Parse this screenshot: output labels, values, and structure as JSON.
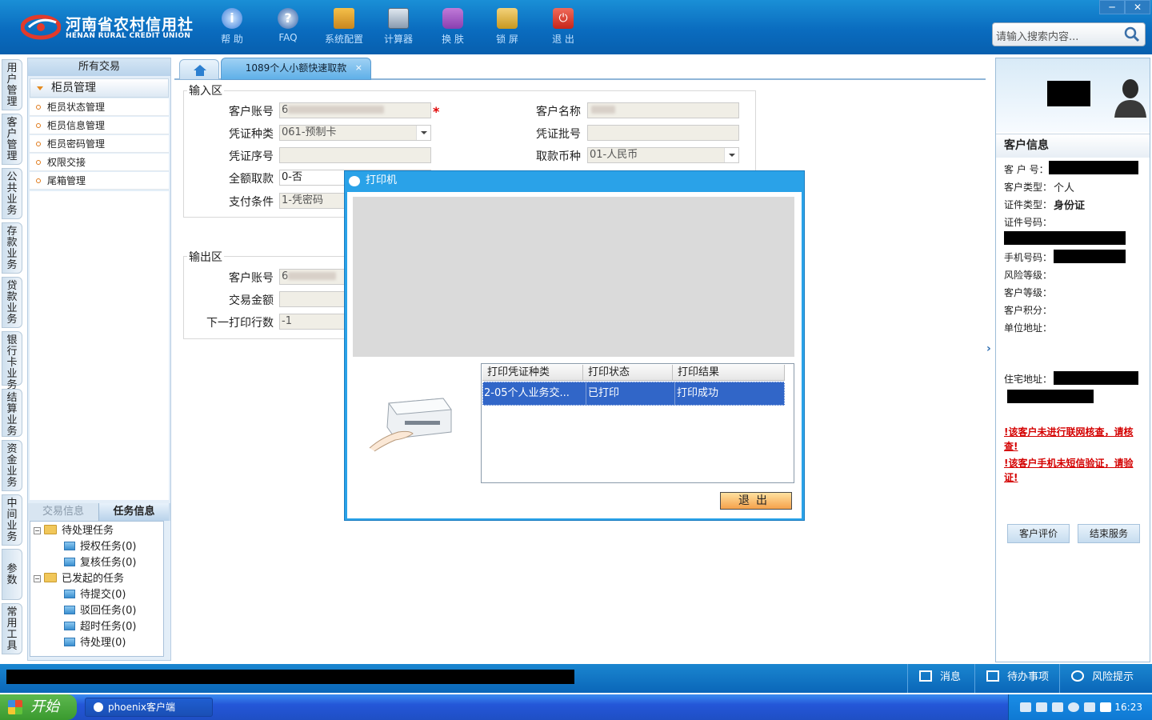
{
  "header": {
    "logo_cn": "河南省农村信用社",
    "logo_en": "HENAN RURAL CREDIT UNION",
    "toolbar": [
      {
        "label": "帮 助",
        "icon": "info-icon"
      },
      {
        "label": "FAQ",
        "icon": "question-icon"
      },
      {
        "label": "系统配置",
        "icon": "toolbox-icon"
      },
      {
        "label": "计算器",
        "icon": "calculator-icon"
      },
      {
        "label": "换 肤",
        "icon": "shirt-icon"
      },
      {
        "label": "锁 屏",
        "icon": "lock-icon"
      },
      {
        "label": "退 出",
        "icon": "power-icon"
      }
    ],
    "search_placeholder": "请输入搜索内容...",
    "win_minimize": "─",
    "win_close": "✕"
  },
  "vtabs": [
    "用户管理",
    "客户管理",
    "公共业务",
    "存款业务",
    "贷款业务",
    "银行卡业务",
    "结算业务",
    "资金业务",
    "中间业务",
    "参数",
    "常用工具"
  ],
  "left_panel": {
    "title": "所有交易",
    "group": "柜员管理",
    "items": [
      "柜员状态管理",
      "柜员信息管理",
      "柜员密码管理",
      "权限交接",
      "尾箱管理"
    ],
    "tabs": [
      "交易信息",
      "任务信息"
    ],
    "tree": {
      "pending": "待处理任务",
      "pending_children": [
        "授权任务(0)",
        "复核任务(0)"
      ],
      "initiated": "已发起的任务",
      "initiated_children": [
        "待提交(0)",
        "驳回任务(0)",
        "超时任务(0)",
        "待处理(0)"
      ]
    }
  },
  "tabs": {
    "active": "1089个人小额快速取款",
    "close": "×"
  },
  "input_section": {
    "title": "输入区",
    "account_label": "客户账号",
    "account_value": "6",
    "required_mark": "*",
    "name_label": "客户名称",
    "voucher_type_label": "凭证种类",
    "voucher_type_value": "061-预制卡",
    "voucher_batch_label": "凭证批号",
    "voucher_seq_label": "凭证序号",
    "currency_label": "取款币种",
    "currency_value": "01-人民币",
    "full_withdraw_label": "全额取款",
    "full_withdraw_value": "0-否",
    "pay_condition_label": "支付条件",
    "pay_condition_value": "1-凭密码"
  },
  "output_section": {
    "title": "输出区",
    "account_label": "客户账号",
    "account_value": "6",
    "amount_label": "交易金额",
    "next_line_label": "下一打印行数",
    "next_line_value": "-1"
  },
  "dialog": {
    "title": "打印机",
    "columns": [
      "打印凭证种类",
      "打印状态",
      "打印结果"
    ],
    "rows": [
      [
        "2-05个人业务交...",
        "已打印",
        "打印成功"
      ]
    ],
    "exit_button": "退出"
  },
  "customer_panel": {
    "title": "客户信息",
    "fields": {
      "customer_no": "客 户 号：",
      "customer_type_label": "客户类型：",
      "customer_type_value": "个人",
      "id_type_label": "证件类型：",
      "id_type_value": "身份证",
      "id_no_label": "证件号码：",
      "phone_label": "手机号码：",
      "risk_label": "风险等级：",
      "level_label": "客户等级：",
      "points_label": "客户积分：",
      "work_addr_label": "单位地址：",
      "home_addr_label": "住宅地址："
    },
    "warnings": [
      "!该客户未进行联网核查，请核查!",
      "!该客户手机未短信验证，请验证!"
    ],
    "buttons": [
      "客户评价",
      "结束服务"
    ]
  },
  "statusbar": {
    "items": [
      "消息",
      "待办事项",
      "风险提示"
    ]
  },
  "taskbar": {
    "start": "开始",
    "app": "phoenix客户端",
    "time": "16:23"
  },
  "colors": {
    "header_blue": "#0a6cbf",
    "dialog_blue": "#2aa2e8",
    "selection_blue": "#3166c8",
    "warning_red": "#d40000",
    "exit_orange": "#f5a14b"
  }
}
